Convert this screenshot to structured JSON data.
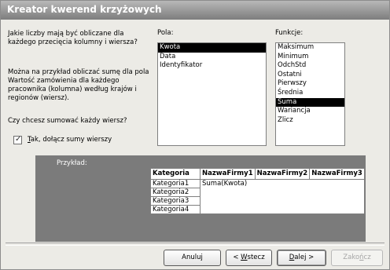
{
  "window": {
    "title": "Kreator kwerend krzyżowych"
  },
  "left": {
    "question": "Jakie liczby mają być obliczane dla każdego przecięcia kolumny i wiersza?",
    "example_text": "Można na przykład obliczać sumę dla pola Wartość zamówienia dla każdego pracownika (kolumna) według krajów i regionów (wiersz).",
    "row_sum_question": "Czy chcesz sumować każdy wiersz?",
    "checkbox_label": "Tak, dołącz sumy wierszy",
    "checkbox_checked": true
  },
  "fields": {
    "label": "Pola:",
    "items": [
      "Kwota",
      "Data",
      "Identyfikator"
    ],
    "selected": "Kwota"
  },
  "functions": {
    "label": "Funkcje:",
    "items": [
      "Maksimum",
      "Minimum",
      "OdchStd",
      "Ostatni",
      "Pierwszy",
      "Średnia",
      "Suma",
      "Wariancja",
      "Zlicz"
    ],
    "selected": "Suma"
  },
  "example": {
    "caption": "Przykład:",
    "headers": [
      "Kategoria",
      "NazwaFirmy1",
      "NazwaFirmy2",
      "NazwaFirmy3"
    ],
    "rows": [
      [
        "Kategoria1",
        "Suma(Kwota)",
        "",
        ""
      ],
      [
        "Kategoria2",
        "",
        "",
        ""
      ],
      [
        "Kategoria3",
        "",
        "",
        ""
      ],
      [
        "Kategoria4",
        "",
        "",
        ""
      ]
    ]
  },
  "buttons": {
    "cancel": "Anuluj",
    "back": "< Wstecz",
    "next": "Dalej >",
    "finish": "Zakończ"
  }
}
